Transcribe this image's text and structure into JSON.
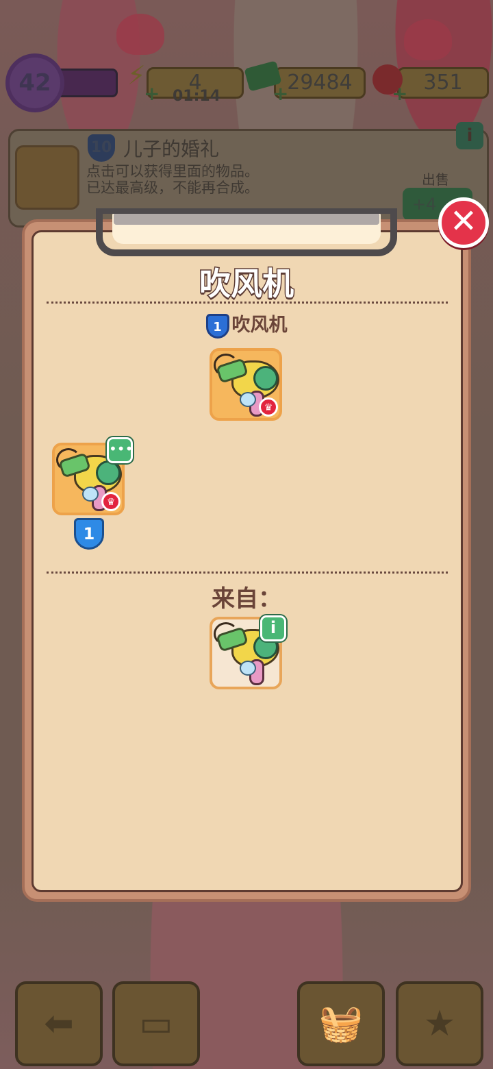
{
  "status_bar": {
    "player_level": "42",
    "energy": "4",
    "energy_timer": "01:14",
    "cash": "29484",
    "gems": "351",
    "icons": [
      "energy-bolt-icon",
      "cash-stack-icon",
      "ruby-gem-icon"
    ]
  },
  "info_card": {
    "item_level": "10",
    "title": "儿子的婚礼",
    "description_line1": "点击可以获得里面的物品。",
    "description_line2": "已达最高级，不能再合成。",
    "sell_label": "出售",
    "sell_value": "+4"
  },
  "modal": {
    "title": "吹风机",
    "chain_level": "1",
    "chain_name": "吹风机",
    "tree_item_level": "1",
    "from_label": "来自："
  },
  "colors": {
    "accent_green": "#49b775",
    "close_red": "#e4334a",
    "paper": "#f0d7b3",
    "level_blue": "#2e8ae6"
  }
}
